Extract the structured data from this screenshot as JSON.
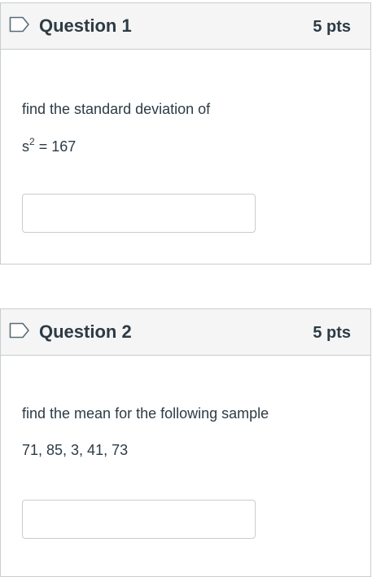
{
  "questions": [
    {
      "title": "Question 1",
      "points": "5 pts",
      "prompt": "find the standard deviation of",
      "expr_base": "s",
      "expr_sup": "2",
      "expr_rest": " = 167",
      "answer_value": ""
    },
    {
      "title": "Question 2",
      "points": "5 pts",
      "prompt": "find the mean for the following sample",
      "data_line": "71, 85, 3, 41, 73",
      "answer_value": ""
    }
  ],
  "colors": {
    "header_bg": "#f5f5f5",
    "border": "#c7cdd1",
    "text": "#2d3b45",
    "flag_stroke": "#2d3b45"
  },
  "icons": {
    "flag": "bookmark-flag-icon"
  }
}
